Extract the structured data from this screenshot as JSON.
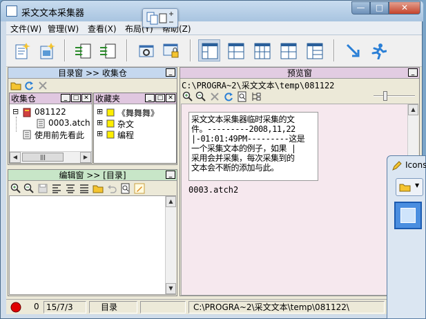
{
  "window": {
    "title": "采文文本采集器",
    "min_label": "—",
    "max_label": "□",
    "close_label": "✕"
  },
  "menu": [
    {
      "label": "文件(W)"
    },
    {
      "label": "管理(W)"
    },
    {
      "label": "查看(X)"
    },
    {
      "label": "布局(Y)"
    },
    {
      "label": "帮助(Z)"
    }
  ],
  "toolbar": {
    "icons": [
      "new-collect-icon",
      "open-folder-icon",
      "import-icon",
      "export-icon",
      "settings-icon",
      "lock-window-icon",
      "layout-1-icon",
      "layout-2-icon",
      "layout-3-icon",
      "layout-4-icon",
      "layout-5-icon",
      "minimize-to-tray-icon",
      "run-icon"
    ]
  },
  "dir_panel": {
    "title": "目录窗 >> 收集仓",
    "min_label": "_"
  },
  "collect_panel": {
    "title": "收集仓",
    "tree": [
      {
        "label": "081122",
        "level": 0,
        "toggle": "⊟"
      },
      {
        "label": "0003.atch",
        "level": 1
      },
      {
        "label": "使用前先看此",
        "level": 0
      }
    ],
    "scroll_arrow_left": "◀",
    "scroll_arrow_right": "▶",
    "scroll_thumb": "|||"
  },
  "fav_panel": {
    "title": "收藏夹",
    "tree": [
      {
        "label": "《舞舞舞》",
        "toggle": "⊞"
      },
      {
        "label": "杂文",
        "toggle": "⊞"
      },
      {
        "label": "编程",
        "toggle": "⊞"
      }
    ]
  },
  "edit_panel": {
    "title": "编辑窗 >> [目录]",
    "min_label": "_",
    "scroll_up": "▲",
    "scroll_down": "▼"
  },
  "preview_panel": {
    "title": "预览窗",
    "min_label": "_",
    "path": "C:\\PROGRA~2\\采文文本\\temp\\081122",
    "content": "采文文本采集器临时采集的文\n件。---------2008,11,22\n|-01:01:49PM---------这是\n一个采集文本的例子，如果 |\n采用会并采集，每次采集到的\n文本会不断的添加与此。",
    "file_label": "0003.atch2",
    "scroll_up": "▲",
    "scroll_down": "▼"
  },
  "icons_window": {
    "title": "Icons"
  },
  "status": {
    "count": "0",
    "date": "15/7/3",
    "mode": "目录",
    "path": "C:\\PROGRA~2\\采文文本\\temp\\081122\\"
  },
  "colors": {
    "dir_title_bg": "#c5d8ef",
    "collect_title_bg": "#e0c7e0",
    "edit_title_bg": "#c8e6c8",
    "preview_title_bg": "#e2cce2",
    "preview_bg": "#f6e8ee",
    "record_red": "#e00000"
  }
}
